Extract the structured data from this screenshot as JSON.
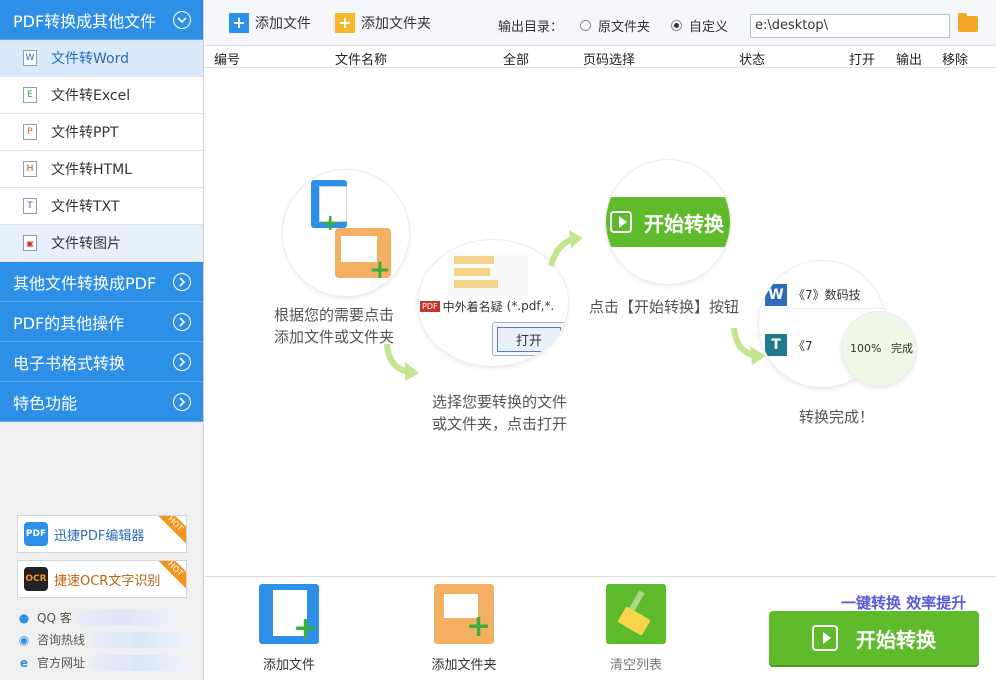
{
  "sidebar": {
    "sections": [
      {
        "label": "PDF转换成其他文件",
        "expanded": true
      },
      {
        "label": "其他文件转换成PDF",
        "expanded": false
      },
      {
        "label": "PDF的其他操作",
        "expanded": false
      },
      {
        "label": "电子书格式转换",
        "expanded": false
      },
      {
        "label": "特色功能",
        "expanded": false
      }
    ],
    "items": [
      {
        "label": "文件转Word",
        "icon": "word-doc-icon",
        "glyph": "W"
      },
      {
        "label": "文件转Excel",
        "icon": "excel-doc-icon",
        "glyph": "E"
      },
      {
        "label": "文件转PPT",
        "icon": "ppt-doc-icon",
        "glyph": "P"
      },
      {
        "label": "文件转HTML",
        "icon": "html-doc-icon",
        "glyph": "H"
      },
      {
        "label": "文件转TXT",
        "icon": "txt-doc-icon",
        "glyph": "T"
      },
      {
        "label": "文件转图片",
        "icon": "image-doc-icon",
        "glyph": "▣"
      }
    ],
    "promos": [
      {
        "label": "迅捷PDF编辑器",
        "hot": "HOT",
        "badge": "PDF"
      },
      {
        "label": "捷速OCR文字识别",
        "hot": "HOT",
        "badge": "OCR"
      }
    ],
    "contacts": [
      {
        "label": "QQ 客",
        "icon": "qq-icon"
      },
      {
        "label": "咨询热线",
        "icon": "headset-icon"
      },
      {
        "label": "官方网址",
        "icon": "ie-icon"
      }
    ]
  },
  "toolbar": {
    "add_file": "添加文件",
    "add_folder": "添加文件夹",
    "output_label": "输出目录：",
    "radio_original": "原文件夹",
    "radio_custom": "自定义",
    "path_value": "e:\\desktop\\"
  },
  "table": {
    "headers": [
      "编号",
      "文件名称",
      "全部",
      "页码选择",
      "状态",
      "打开",
      "输出",
      "移除"
    ]
  },
  "guide": {
    "step1": [
      "根据您的需要点击",
      "添加文件或文件夹"
    ],
    "step2": [
      "选择您要转换的文件",
      "或文件夹，点击打开"
    ],
    "step3": "点击【开始转换】按钮",
    "step4": "转换完成！",
    "step2_file": "中外着名疑",
    "step2_filter": "(*.pdf,*.",
    "step2_open": "打开",
    "step3_btn": "开始转换",
    "step4_row1": "《7》数码技",
    "step4_row2": "《7",
    "step4_progress": "100%",
    "step4_done": "完成"
  },
  "bottom": {
    "add_file": "添加文件",
    "add_folder": "添加文件夹",
    "clear": "清空列表",
    "slogan": "一键转换  效率提升",
    "start": "开始转换"
  },
  "colors": {
    "sidebar_blue": "#2e8fe6",
    "start_green": "#5fbb2c",
    "slogan_purple": "#5b5bd6"
  }
}
